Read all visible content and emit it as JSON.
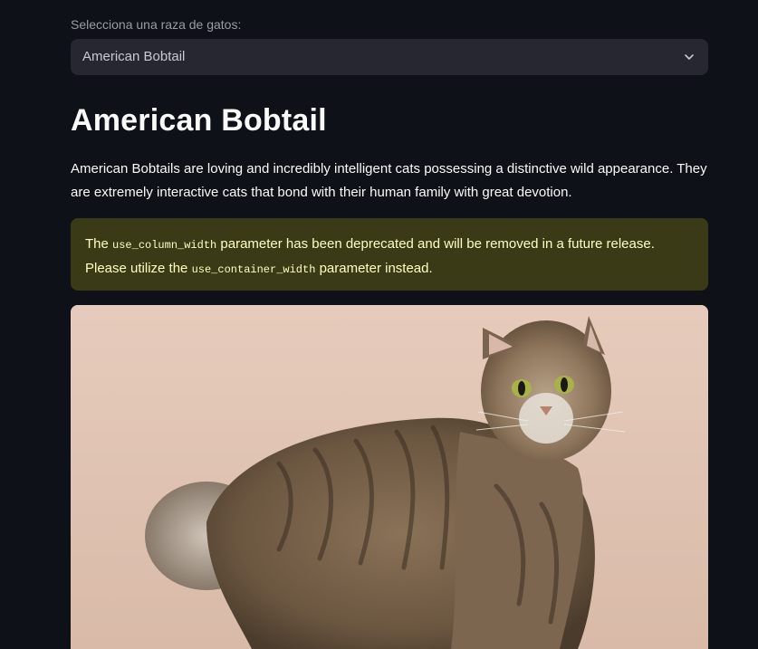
{
  "selector": {
    "label": "Selecciona una raza de gatos:",
    "value": "American Bobtail"
  },
  "breed": {
    "title": "American Bobtail",
    "description": "American Bobtails are loving and incredibly intelligent cats possessing a distinctive wild appearance. They are extremely interactive cats that bond with their human family with great devotion."
  },
  "warning": {
    "text_1": "The ",
    "code_1": "use_column_width",
    "text_2": " parameter has been deprecated and will be removed in a future release. Please utilize the ",
    "code_2": "use_container_width",
    "text_3": " parameter instead."
  },
  "colors": {
    "background": "#0e1117",
    "select_bg": "#262730",
    "warning_bg": "#3b3a17",
    "warning_text": "#ffffc2"
  },
  "icons": {
    "dropdown": "chevron-down-icon"
  }
}
